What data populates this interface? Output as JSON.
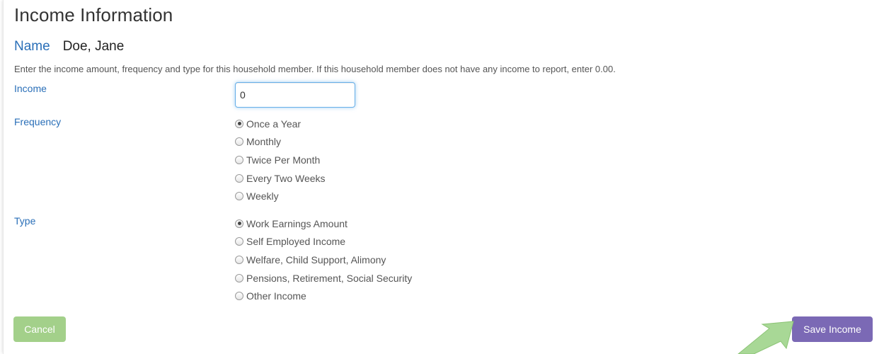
{
  "page": {
    "title": "Income Information",
    "name_label": "Name",
    "name_value": "Doe, Jane",
    "instructions": "Enter the income amount, frequency and type for this household member. If this household member does not have any income to report, enter 0.00."
  },
  "income": {
    "label": "Income",
    "value": "0"
  },
  "frequency": {
    "label": "Frequency",
    "selected": "Once a Year",
    "options": [
      "Once a Year",
      "Monthly",
      "Twice Per Month",
      "Every Two Weeks",
      "Weekly"
    ]
  },
  "type": {
    "label": "Type",
    "selected": "Work Earnings Amount",
    "options": [
      "Work Earnings Amount",
      "Self Employed Income",
      "Welfare, Child Support, Alimony",
      "Pensions, Retirement, Social Security",
      "Other Income"
    ]
  },
  "buttons": {
    "cancel_label": "Cancel",
    "save_label": "Save Income"
  },
  "colors": {
    "label_blue": "#2a6fb8",
    "cancel_green": "#a3d08a",
    "save_purple": "#7b69b5",
    "hint_arrow_green": "#a8d896"
  },
  "icons": {
    "hint": "arrow-up-right-icon"
  }
}
